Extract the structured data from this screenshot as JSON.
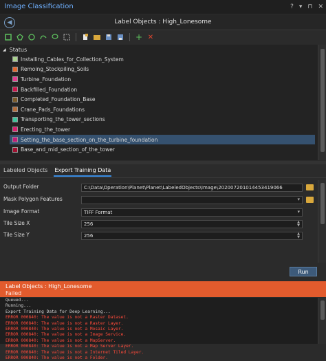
{
  "window": {
    "title": "Image Classification",
    "controls": [
      "?",
      "▾",
      "⊓",
      "✕"
    ]
  },
  "header": {
    "title": "Label Objects : High_Lonesome"
  },
  "tree": {
    "root_label": "Status",
    "items": [
      {
        "label": "Installing_Cables_for_Collection_System",
        "color": "#a8d08d"
      },
      {
        "label": "Remoing_Stockpiling_Soils",
        "color": "#e0672f"
      },
      {
        "label": "Turbine_Foundation",
        "color": "#e23b8f"
      },
      {
        "label": "Backfilled_Foundation",
        "color": "#c8154a"
      },
      {
        "label": "Completed_Foundation_Base",
        "color": "#7a5a2a"
      },
      {
        "label": "Crane_Pads_Foundations",
        "color": "#b06c3a"
      },
      {
        "label": "Transporting_the_tower_sections",
        "color": "#3cc49a"
      },
      {
        "label": "Erecting_the_tower",
        "color": "#d6206e"
      },
      {
        "label": "Setting_the_base_section_on_the_turbine_foundation",
        "color": "#c01c7a",
        "selected": true
      },
      {
        "label": "Base_and_mid_section_of_the_tower",
        "color": "#a01030"
      }
    ]
  },
  "tabs": [
    {
      "label": "Labeled Objects",
      "active": false
    },
    {
      "label": "Export Training Data",
      "active": true
    }
  ],
  "form": {
    "output_folder_label": "Output Folder",
    "output_folder_value": "C:\\Data\\Operation\\Planet\\Planet\\LabeledObjects\\Image\\20200720101445341906​6",
    "mask_label": "Mask Polygon Features",
    "mask_value": "",
    "format_label": "Image Format",
    "format_value": "TIFF Format",
    "tilex_label": "Tile Size X",
    "tilex_value": "256",
    "tiley_label": "Tile Size Y",
    "tiley_value": "256",
    "run_label": "Run"
  },
  "status": {
    "title": "Label Objects : High_Lonesome",
    "state": "Failed",
    "log": [
      {
        "text": "Queued...",
        "type": "ok"
      },
      {
        "text": "Running...",
        "type": "ok"
      },
      {
        "text": "Export Training Data for Deep Learning...",
        "type": "ok"
      },
      {
        "text": "ERROR 000840: The value is not a Raster Dataset.",
        "type": "err"
      },
      {
        "text": "ERROR 000840: The value is not a Raster Layer.",
        "type": "err"
      },
      {
        "text": "ERROR 000840: The value is not a Mosaic Layer.",
        "type": "err"
      },
      {
        "text": "ERROR 000840: The value is not a Image Service.",
        "type": "err"
      },
      {
        "text": "ERROR 000840: The value is not a MapServer.",
        "type": "err"
      },
      {
        "text": "ERROR 000840: The value is not a Map Server Layer.",
        "type": "err"
      },
      {
        "text": "ERROR 000840: The value is not a Internet Tiled Layer.",
        "type": "err"
      },
      {
        "text": "ERROR 000840: The value is not a Folder.",
        "type": "err"
      }
    ]
  }
}
